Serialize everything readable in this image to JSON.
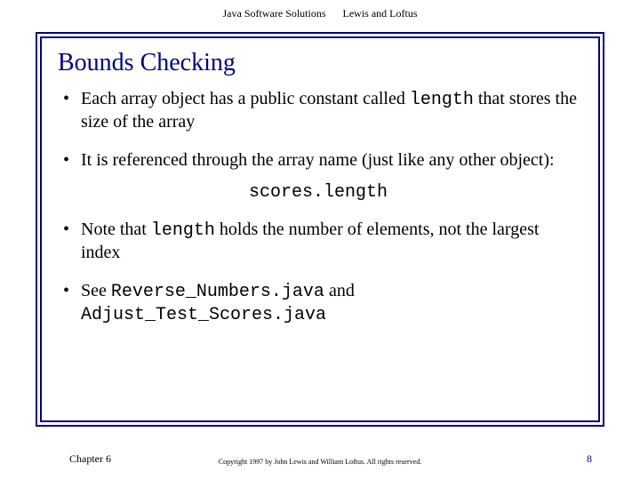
{
  "header": {
    "book": "Java Software Solutions",
    "authors": "Lewis and Loftus"
  },
  "slide": {
    "title": "Bounds Checking",
    "bullets": [
      {
        "pre": "Each array object has a public constant called ",
        "code": "length",
        "post": " that stores the size of the array"
      },
      {
        "pre": "It is referenced through the array name (just like any other object):",
        "code": "",
        "post": ""
      }
    ],
    "code_line": "scores.length",
    "bullet3": {
      "pre": "Note that ",
      "code": "length",
      "post": " holds the number of elements, not the largest index"
    },
    "bullet4": {
      "pre": "See ",
      "code1": "Reverse_Numbers.java",
      "mid": " and ",
      "code2": "Adjust_Test_Scores.java"
    }
  },
  "footer": {
    "chapter": "Chapter 6",
    "copyright": "Copyright 1997 by John Lewis and William Loftus. All rights reserved.",
    "page": "8"
  }
}
